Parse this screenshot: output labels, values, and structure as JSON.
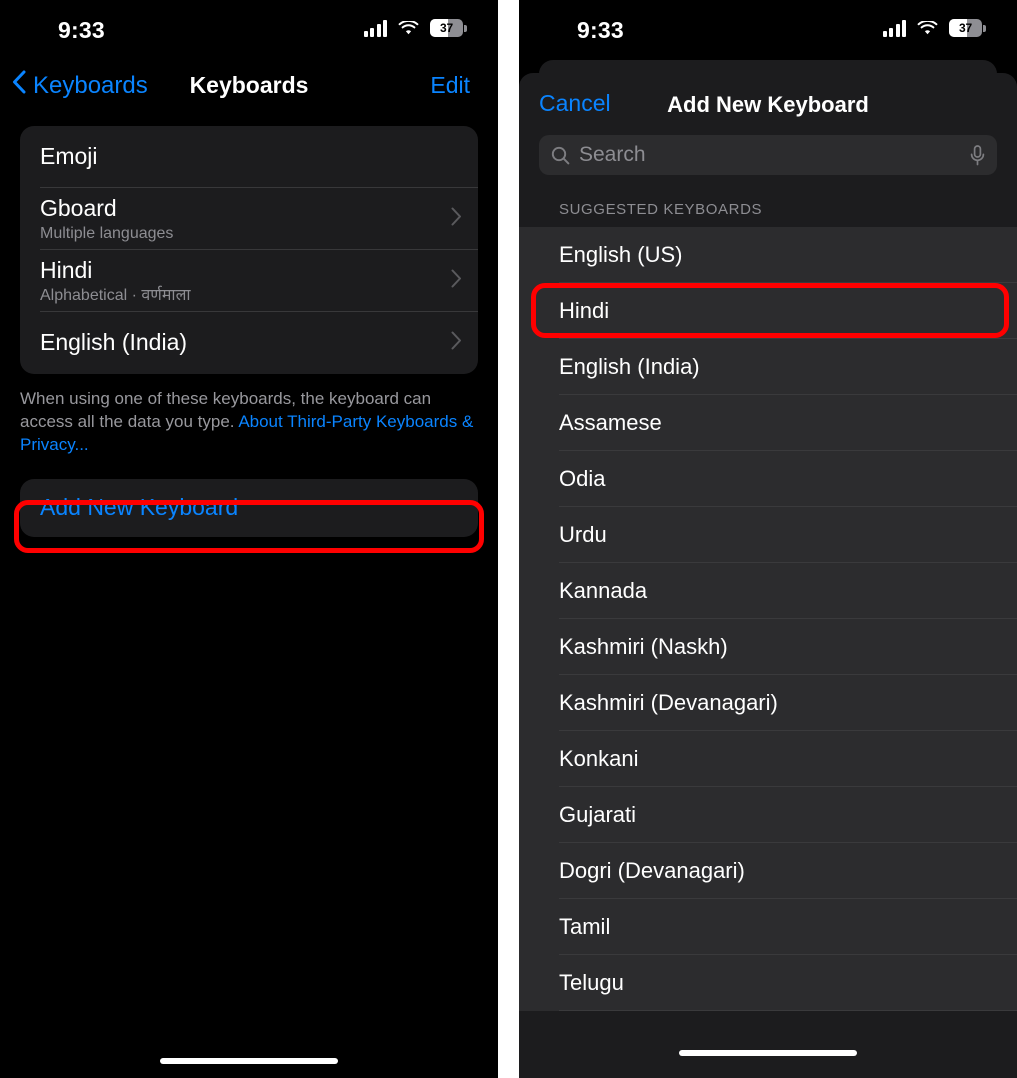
{
  "status_bar": {
    "time": "9:33",
    "battery_level": "37",
    "icons": [
      "cellular-signal-icon",
      "wifi-icon",
      "battery-icon"
    ]
  },
  "left_panel": {
    "nav": {
      "back_label": "Keyboards",
      "title": "Keyboards",
      "edit_label": "Edit"
    },
    "keyboards": [
      {
        "title": "Emoji",
        "subtitle": "",
        "has_chevron": false
      },
      {
        "title": "Gboard",
        "subtitle": "Multiple languages",
        "has_chevron": true
      },
      {
        "title": "Hindi",
        "subtitle": "Alphabetical · वर्णमाला",
        "has_chevron": true
      },
      {
        "title": "English (India)",
        "subtitle": "",
        "has_chevron": true
      }
    ],
    "footer_note_text": "When using one of these keyboards, the keyboard can access all the data you type. ",
    "footer_note_link": "About Third-Party Keyboards & Privacy...",
    "add_new_keyboard_label": "Add New Keyboard"
  },
  "right_panel": {
    "nav": {
      "cancel_label": "Cancel",
      "title": "Add New Keyboard"
    },
    "search": {
      "placeholder": "Search",
      "value": ""
    },
    "section_header": "SUGGESTED KEYBOARDS",
    "keyboards": [
      "English (US)",
      "Hindi",
      "English (India)",
      "Assamese",
      "Odia",
      "Urdu",
      "Kannada",
      "Kashmiri (Naskh)",
      "Kashmiri (Devanagari)",
      "Konkani",
      "Gujarati",
      "Dogri (Devanagari)",
      "Tamil",
      "Telugu"
    ]
  },
  "annotations": {
    "color": "#ff0000",
    "highlighted": [
      "Add New Keyboard",
      "English (US)"
    ]
  },
  "colors": {
    "accent_blue": "#0a84ff",
    "card_bg": "#1c1c1e",
    "row_bg": "#2c2c2e",
    "screen_bg": "#000000",
    "secondary_text": "#8d8d92"
  }
}
